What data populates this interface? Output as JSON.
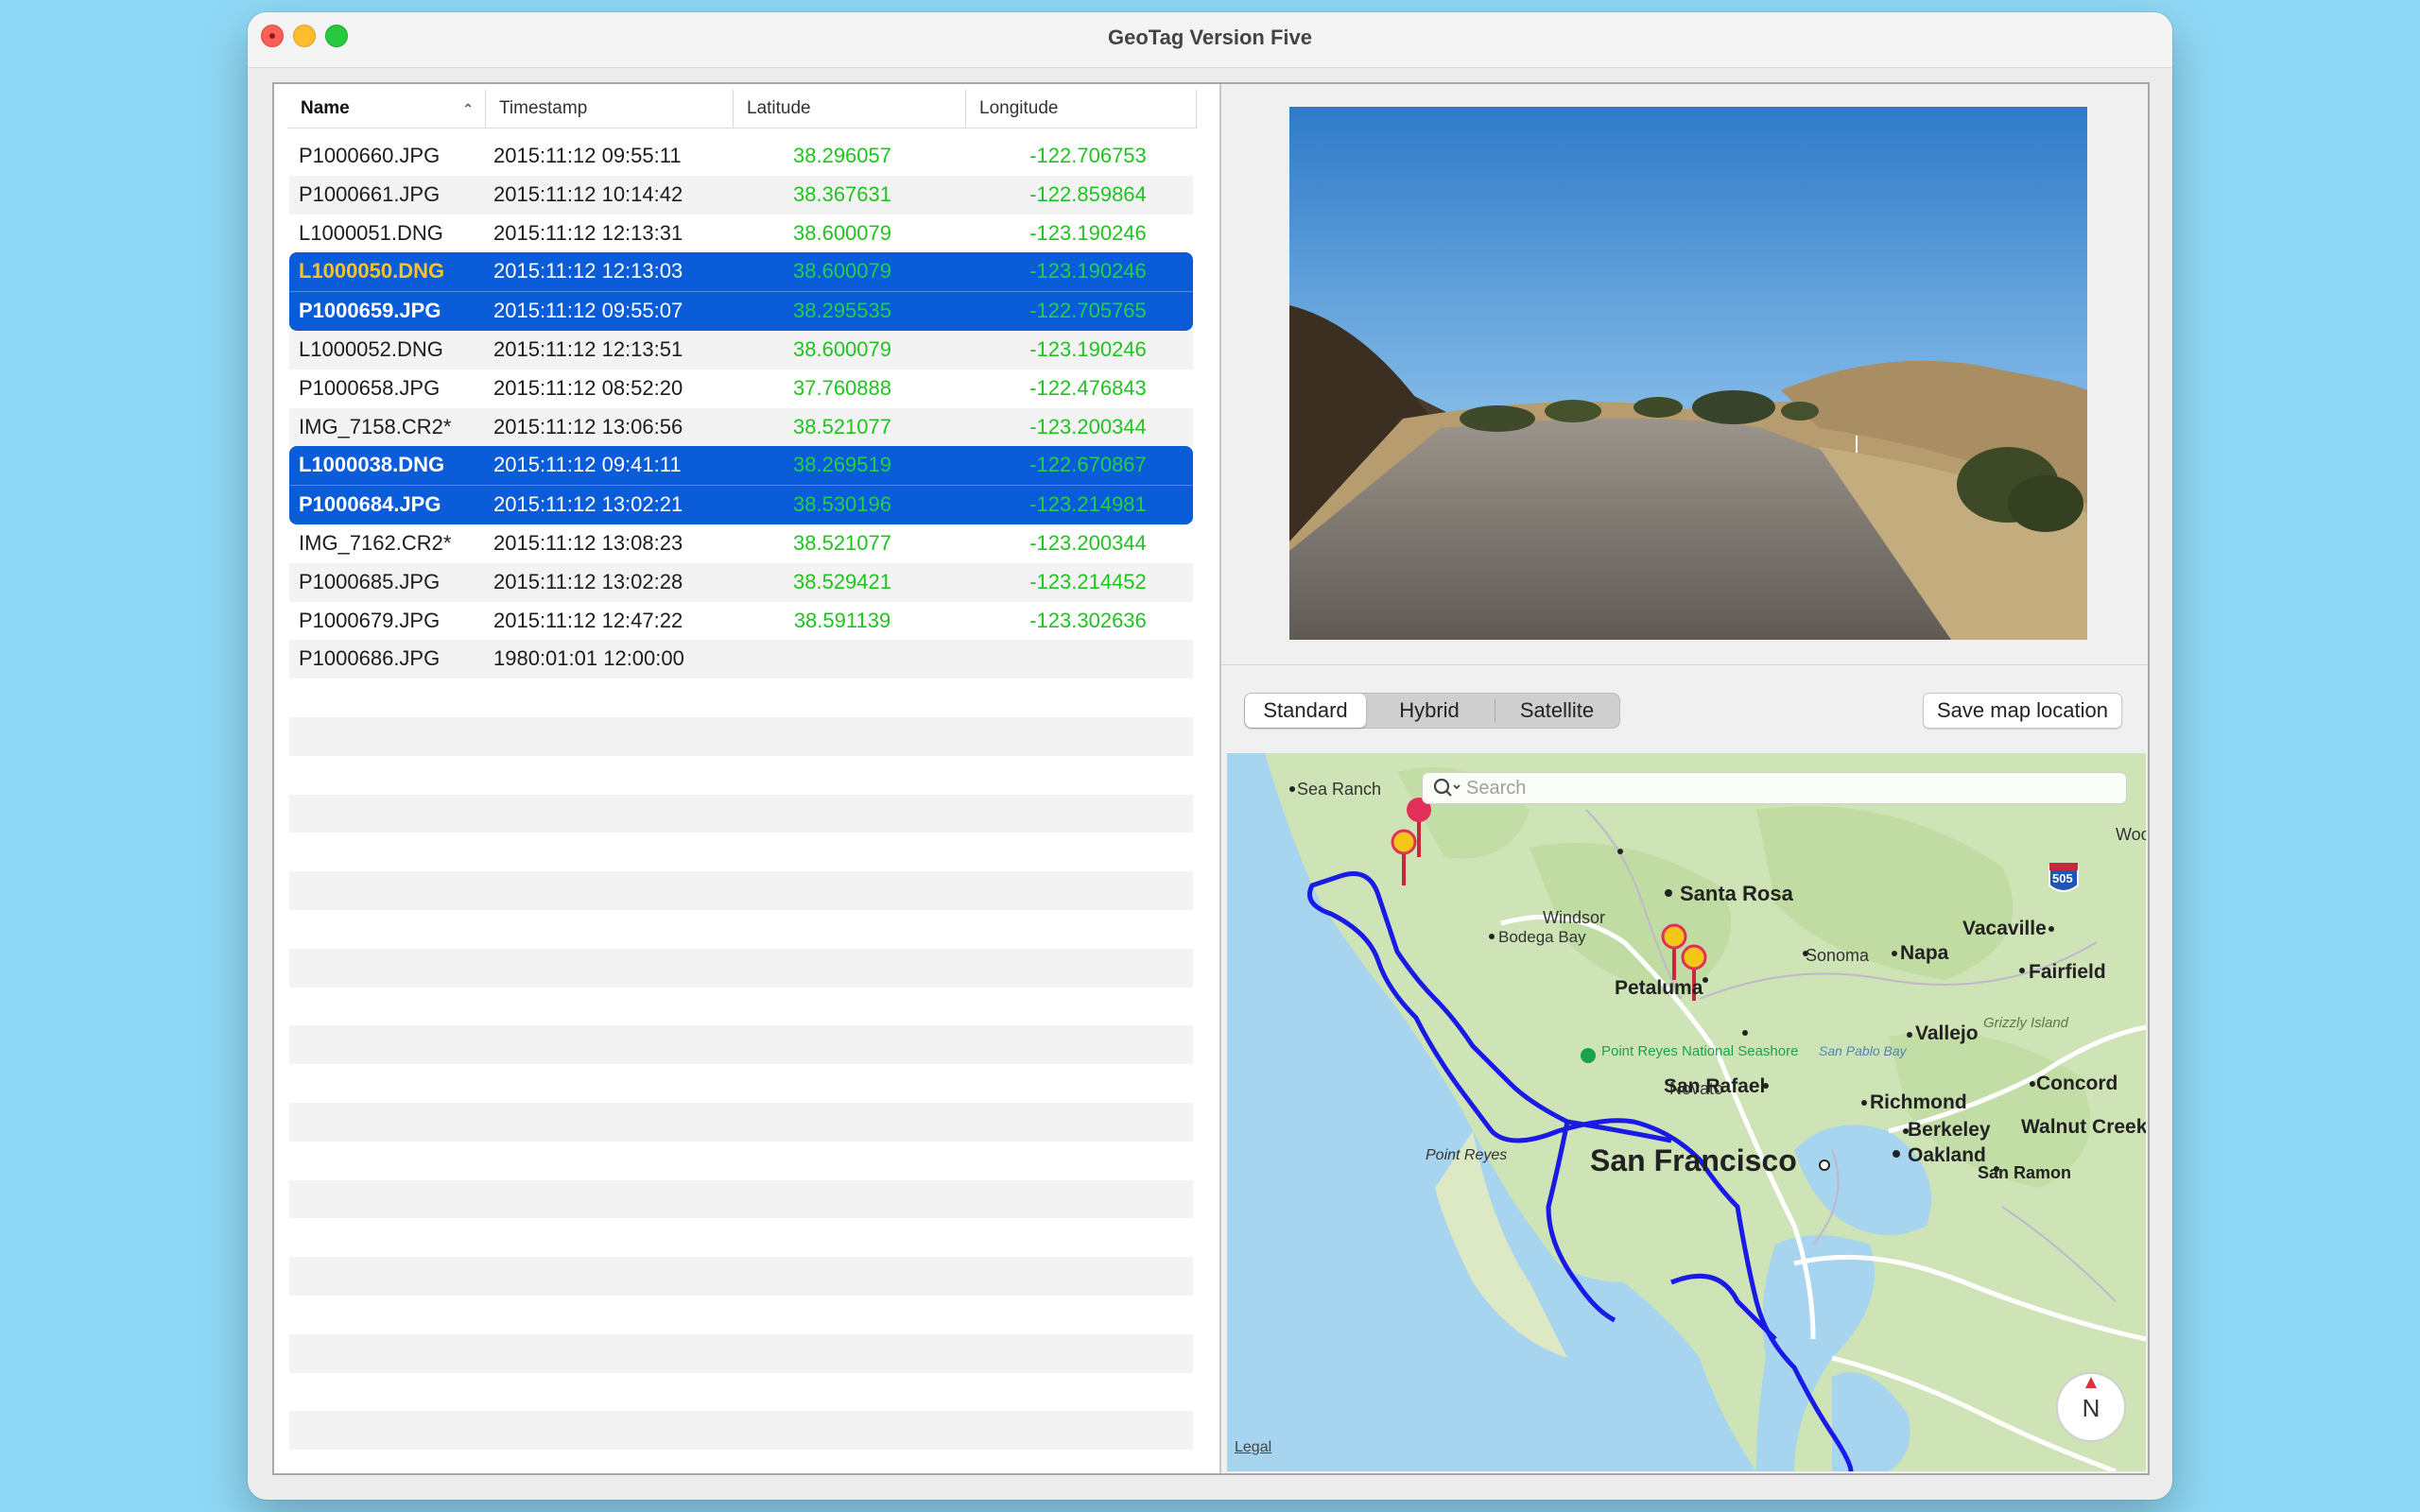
{
  "window": {
    "title": "GeoTag Version Five"
  },
  "table": {
    "columns": {
      "name": "Name",
      "timestamp": "Timestamp",
      "latitude": "Latitude",
      "longitude": "Longitude"
    },
    "rows": [
      {
        "name": "P1000660.JPG",
        "timestamp": "2015:11:12 09:55:11",
        "latitude": "38.296057",
        "longitude": "-122.706753",
        "selected": false
      },
      {
        "name": "P1000661.JPG",
        "timestamp": "2015:11:12 10:14:42",
        "latitude": "38.367631",
        "longitude": "-122.859864",
        "selected": false
      },
      {
        "name": "L1000051.DNG",
        "timestamp": "2015:11:12 12:13:31",
        "latitude": "38.600079",
        "longitude": "-123.190246",
        "selected": false
      },
      {
        "name": "L1000050.DNG",
        "timestamp": "2015:11:12 12:13:03",
        "latitude": "38.600079",
        "longitude": "-123.190246",
        "selected": true,
        "primary": true
      },
      {
        "name": "P1000659.JPG",
        "timestamp": "2015:11:12 09:55:07",
        "latitude": "38.295535",
        "longitude": "-122.705765",
        "selected": true
      },
      {
        "name": "L1000052.DNG",
        "timestamp": "2015:11:12 12:13:51",
        "latitude": "38.600079",
        "longitude": "-123.190246",
        "selected": false
      },
      {
        "name": "P1000658.JPG",
        "timestamp": "2015:11:12 08:52:20",
        "latitude": "37.760888",
        "longitude": "-122.476843",
        "selected": false
      },
      {
        "name": "IMG_7158.CR2*",
        "timestamp": "2015:11:12 13:06:56",
        "latitude": "38.521077",
        "longitude": "-123.200344",
        "selected": false
      },
      {
        "name": "L1000038.DNG",
        "timestamp": "2015:11:12 09:41:11",
        "latitude": "38.269519",
        "longitude": "-122.670867",
        "selected": true
      },
      {
        "name": "P1000684.JPG",
        "timestamp": "2015:11:12 13:02:21",
        "latitude": "38.530196",
        "longitude": "-123.214981",
        "selected": true
      },
      {
        "name": "IMG_7162.CR2*",
        "timestamp": "2015:11:12 13:08:23",
        "latitude": "38.521077",
        "longitude": "-123.200344",
        "selected": false
      },
      {
        "name": "P1000685.JPG",
        "timestamp": "2015:11:12 13:02:28",
        "latitude": "38.529421",
        "longitude": "-123.214452",
        "selected": false
      },
      {
        "name": "P1000679.JPG",
        "timestamp": "2015:11:12 12:47:22",
        "latitude": "38.591139",
        "longitude": "-123.302636",
        "selected": false
      },
      {
        "name": "P1000686.JPG",
        "timestamp": "1980:01:01 12:00:00",
        "latitude": "",
        "longitude": "",
        "selected": false
      }
    ]
  },
  "map_controls": {
    "segments": [
      "Standard",
      "Hybrid",
      "Satellite"
    ],
    "active_segment": "Standard",
    "save_label": "Save map location",
    "search_placeholder": "Search",
    "legal": "Legal",
    "compass": "N"
  },
  "map_labels": {
    "sea_ranch": "Sea Ranch",
    "woodland": "Woodlar",
    "windsor": "Windsor",
    "santa_rosa": "Santa Rosa",
    "vacaville": "Vacaville",
    "bodega_bay": "Bodega Bay",
    "sonoma": "Sonoma",
    "napa": "Napa",
    "fairfield": "Fairfield",
    "petaluma": "Petaluma",
    "novato": "Novato",
    "vallejo": "Vallejo",
    "grizzly_island": "Grizzly Island",
    "san_pablo_bay": "San Pablo Bay",
    "point_reyes_ns": "Point Reyes National Seashore",
    "point_reyes": "Point Reyes",
    "san_rafael": "San Rafael",
    "concord": "Concord",
    "richmond": "Richmond",
    "berkeley": "Berkeley",
    "walnut_creek": "Walnut Creek",
    "oakland": "Oakland",
    "san_francisco": "San Francisco",
    "san_ramon": "San Ramon",
    "interstate": "505"
  },
  "colors": {
    "selection": "#0b5cd8",
    "coordinate_text": "#1fc41f",
    "primary_selected_name": "#f7c327",
    "track": "#1a1ae6",
    "pin_selected": "#f5c518",
    "pin_other": "#e0305a"
  }
}
